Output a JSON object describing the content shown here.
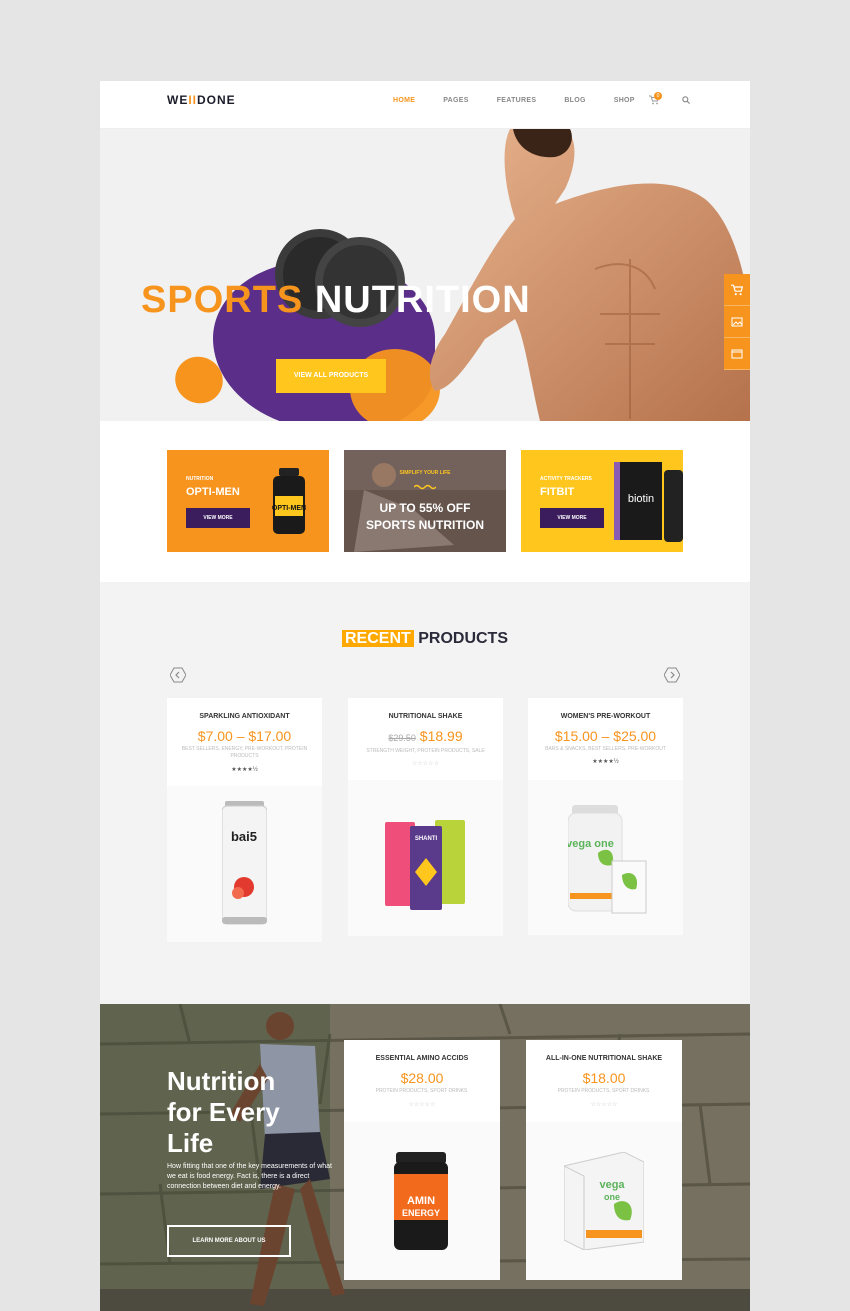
{
  "header": {
    "logo_prefix": "WE",
    "logo_accent": "II",
    "logo_suffix": "DONE",
    "nav": [
      "HOME",
      "PAGES",
      "FEATURES",
      "BLOG",
      "SHOP"
    ],
    "cart_count": "0"
  },
  "hero": {
    "title_orange": "SPORTS",
    "title_white": "NUTRITION",
    "button": "VIEW ALL PRODUCTS"
  },
  "promos": [
    {
      "kicker": "NUTRITION",
      "title": "OPTI-MEN",
      "button": "VIEW MORE",
      "product_label": "OPTI-MEN"
    },
    {
      "kicker": "SIMPLIFY YOUR LIFE",
      "title_line1": "UP TO 55% OFF",
      "title_line2": "SPORTS NUTRITION"
    },
    {
      "kicker": "ACTIVITY TRACKERS",
      "title": "FITBIT",
      "button": "VIEW MORE",
      "product_label": "biotin"
    }
  ],
  "recent": {
    "heading_highlight": "RECENT",
    "heading_rest": "PRODUCTS",
    "products": [
      {
        "name": "SPARKLING ANTIOXIDANT",
        "price": "$7.00 – $17.00",
        "old_price": "",
        "categories": "BEST SELLERS, ENERGY, PRE-WORKOUT, PROTEIN PRODUCTS",
        "stars": "★★★★½",
        "label": "bai5"
      },
      {
        "name": "NUTRITIONAL SHAKE",
        "price": "$18.99",
        "old_price": "$29.50",
        "categories": "STRENGTH WEIGHT, PROTEIN PRODUCTS, SALE",
        "stars": "☆☆☆☆☆",
        "label": "SHANTI"
      },
      {
        "name": "WOMEN'S PRE-WORKOUT",
        "price": "$15.00 – $25.00",
        "old_price": "",
        "categories": "BARS & SNACKS, BEST SELLERS, PRE-WORKOUT",
        "stars": "★★★★½",
        "label": "vega one"
      }
    ]
  },
  "bottom": {
    "title_line1": "Nutrition",
    "title_line2": "for Every",
    "title_line3": "Life",
    "text": "How fitting that one of the key measurements of what we eat is food energy. Fact is, there is a direct connection between diet and energy.",
    "button": "LEARN MORE ABOUT US",
    "products": [
      {
        "name": "ESSENTIAL AMINO ACCIDS",
        "price": "$28.00",
        "categories": "PROTEIN PRODUCTS, SPORT DRINKS",
        "stars": "☆☆☆☆☆",
        "label_top": "AMIN",
        "label_bottom": "ENERGY"
      },
      {
        "name": "ALL-IN-ONE NUTRITIONAL SHAKE",
        "price": "$18.00",
        "categories": "PROTEIN PRODUCTS, SPORT DRINKS",
        "stars": "☆☆☆☆☆",
        "label_top": "vega",
        "label_bottom": "one"
      }
    ]
  },
  "colors": {
    "orange": "#f7941d",
    "yellow": "#ffc61e",
    "purple": "#5b2e8a",
    "dark": "#2a2a3a"
  }
}
